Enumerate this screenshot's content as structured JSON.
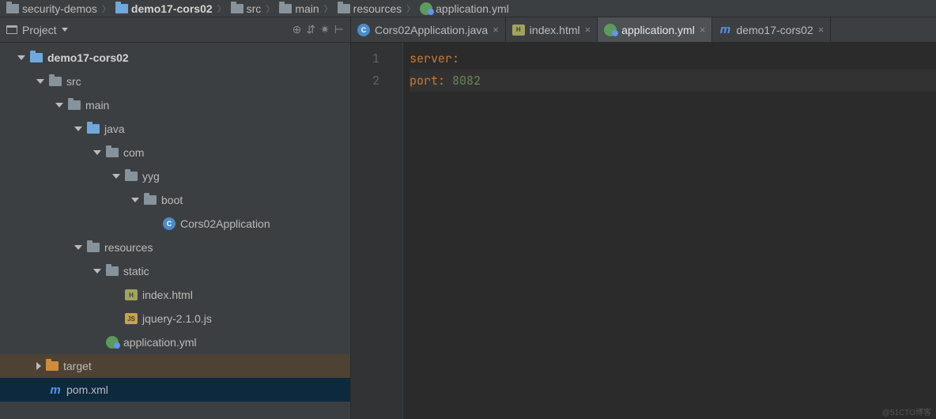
{
  "breadcrumb": {
    "items": [
      {
        "label": "security-demos",
        "icon": "folder"
      },
      {
        "label": "demo17-cors02",
        "icon": "folder-module",
        "bold": true
      },
      {
        "label": "src",
        "icon": "folder"
      },
      {
        "label": "main",
        "icon": "folder"
      },
      {
        "label": "resources",
        "icon": "folder-resources"
      },
      {
        "label": "application.yml",
        "icon": "yml"
      }
    ]
  },
  "project": {
    "title": "Project"
  },
  "tree": [
    {
      "depth": 0,
      "arrow": "down",
      "icon": "folder-module",
      "label": "demo17-cors02",
      "bold": true
    },
    {
      "depth": 1,
      "arrow": "down",
      "icon": "folder",
      "label": "src"
    },
    {
      "depth": 2,
      "arrow": "down",
      "icon": "folder",
      "label": "main"
    },
    {
      "depth": 3,
      "arrow": "down",
      "icon": "folder-module",
      "label": "java"
    },
    {
      "depth": 4,
      "arrow": "down",
      "icon": "folder",
      "label": "com"
    },
    {
      "depth": 5,
      "arrow": "down",
      "icon": "folder",
      "label": "yyg"
    },
    {
      "depth": 6,
      "arrow": "down",
      "icon": "folder",
      "label": "boot"
    },
    {
      "depth": 7,
      "arrow": "none",
      "icon": "class",
      "label": "Cors02Application"
    },
    {
      "depth": 3,
      "arrow": "down",
      "icon": "folder-resources",
      "label": "resources"
    },
    {
      "depth": 4,
      "arrow": "down",
      "icon": "folder",
      "label": "static"
    },
    {
      "depth": 5,
      "arrow": "none",
      "icon": "html",
      "label": "index.html"
    },
    {
      "depth": 5,
      "arrow": "none",
      "icon": "js",
      "label": "jquery-2.1.0.js"
    },
    {
      "depth": 4,
      "arrow": "none",
      "icon": "yml",
      "label": "application.yml"
    },
    {
      "depth": 1,
      "arrow": "right",
      "icon": "folder-target",
      "label": "target",
      "class": "target"
    },
    {
      "depth": 1,
      "arrow": "none",
      "icon": "maven",
      "label": "pom.xml",
      "class": "selected"
    }
  ],
  "tabs": [
    {
      "icon": "class",
      "label": "Cors02Application.java",
      "active": false
    },
    {
      "icon": "html",
      "label": "index.html",
      "active": false
    },
    {
      "icon": "yml",
      "label": "application.yml",
      "active": true
    },
    {
      "icon": "maven",
      "label": "demo17-cors02",
      "active": false
    }
  ],
  "editor": {
    "lines": [
      {
        "num": "1",
        "tokens": [
          {
            "t": "server",
            "c": "key"
          },
          {
            "t": ":",
            "c": "colon"
          }
        ]
      },
      {
        "num": "2",
        "tokens": [
          {
            "t": "  port",
            "c": "key"
          },
          {
            "t": ": ",
            "c": "colon"
          },
          {
            "t": "8082",
            "c": "val"
          }
        ],
        "current": true
      }
    ]
  },
  "watermark": "@51CTO博客"
}
